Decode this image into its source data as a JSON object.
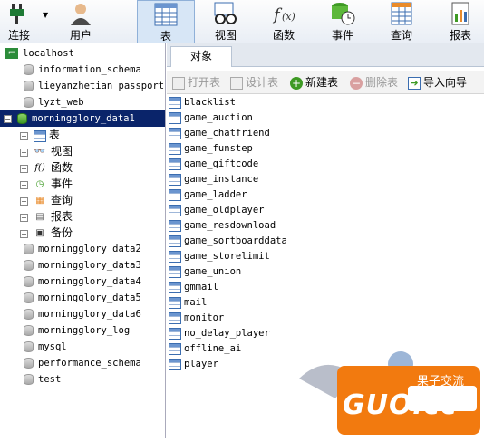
{
  "toolbar": {
    "connect": "连接",
    "user": "用户",
    "table": "表",
    "view": "视图",
    "function": "函数",
    "event": "事件",
    "query": "查询",
    "report": "报表"
  },
  "tree": {
    "connection": "localhost",
    "databases": [
      "information_schema",
      "lieyanzhetian_passport",
      "lyzt_web"
    ],
    "open_database": "morningglory_data1",
    "objects": [
      "表",
      "视图",
      "函数",
      "事件",
      "查询",
      "报表",
      "备份"
    ],
    "more_databases": [
      "morningglory_data2",
      "morningglory_data3",
      "morningglory_data4",
      "morningglory_data5",
      "morningglory_data6",
      "morningglory_log",
      "mysql",
      "performance_schema",
      "test"
    ]
  },
  "tabs": {
    "objects": "对象"
  },
  "actions": {
    "open_table": "打开表",
    "design_table": "设计表",
    "new_table": "新建表",
    "delete_table": "删除表",
    "import_wizard": "导入向导"
  },
  "tables": [
    "blacklist",
    "game_auction",
    "game_chatfriend",
    "game_funstep",
    "game_giftcode",
    "game_instance",
    "game_ladder",
    "game_oldplayer",
    "game_resdownload",
    "game_sortboarddata",
    "game_storelimit",
    "game_union",
    "gmmail",
    "mail",
    "monitor",
    "no_delay_player",
    "offline_ai",
    "player"
  ],
  "watermark": {
    "logo": "GUO.cc",
    "tagline": "果子交流"
  },
  "colors": {
    "selection": "#0a246a",
    "db_active": "#3e9a24",
    "accent_orange": "#f27a0f"
  }
}
